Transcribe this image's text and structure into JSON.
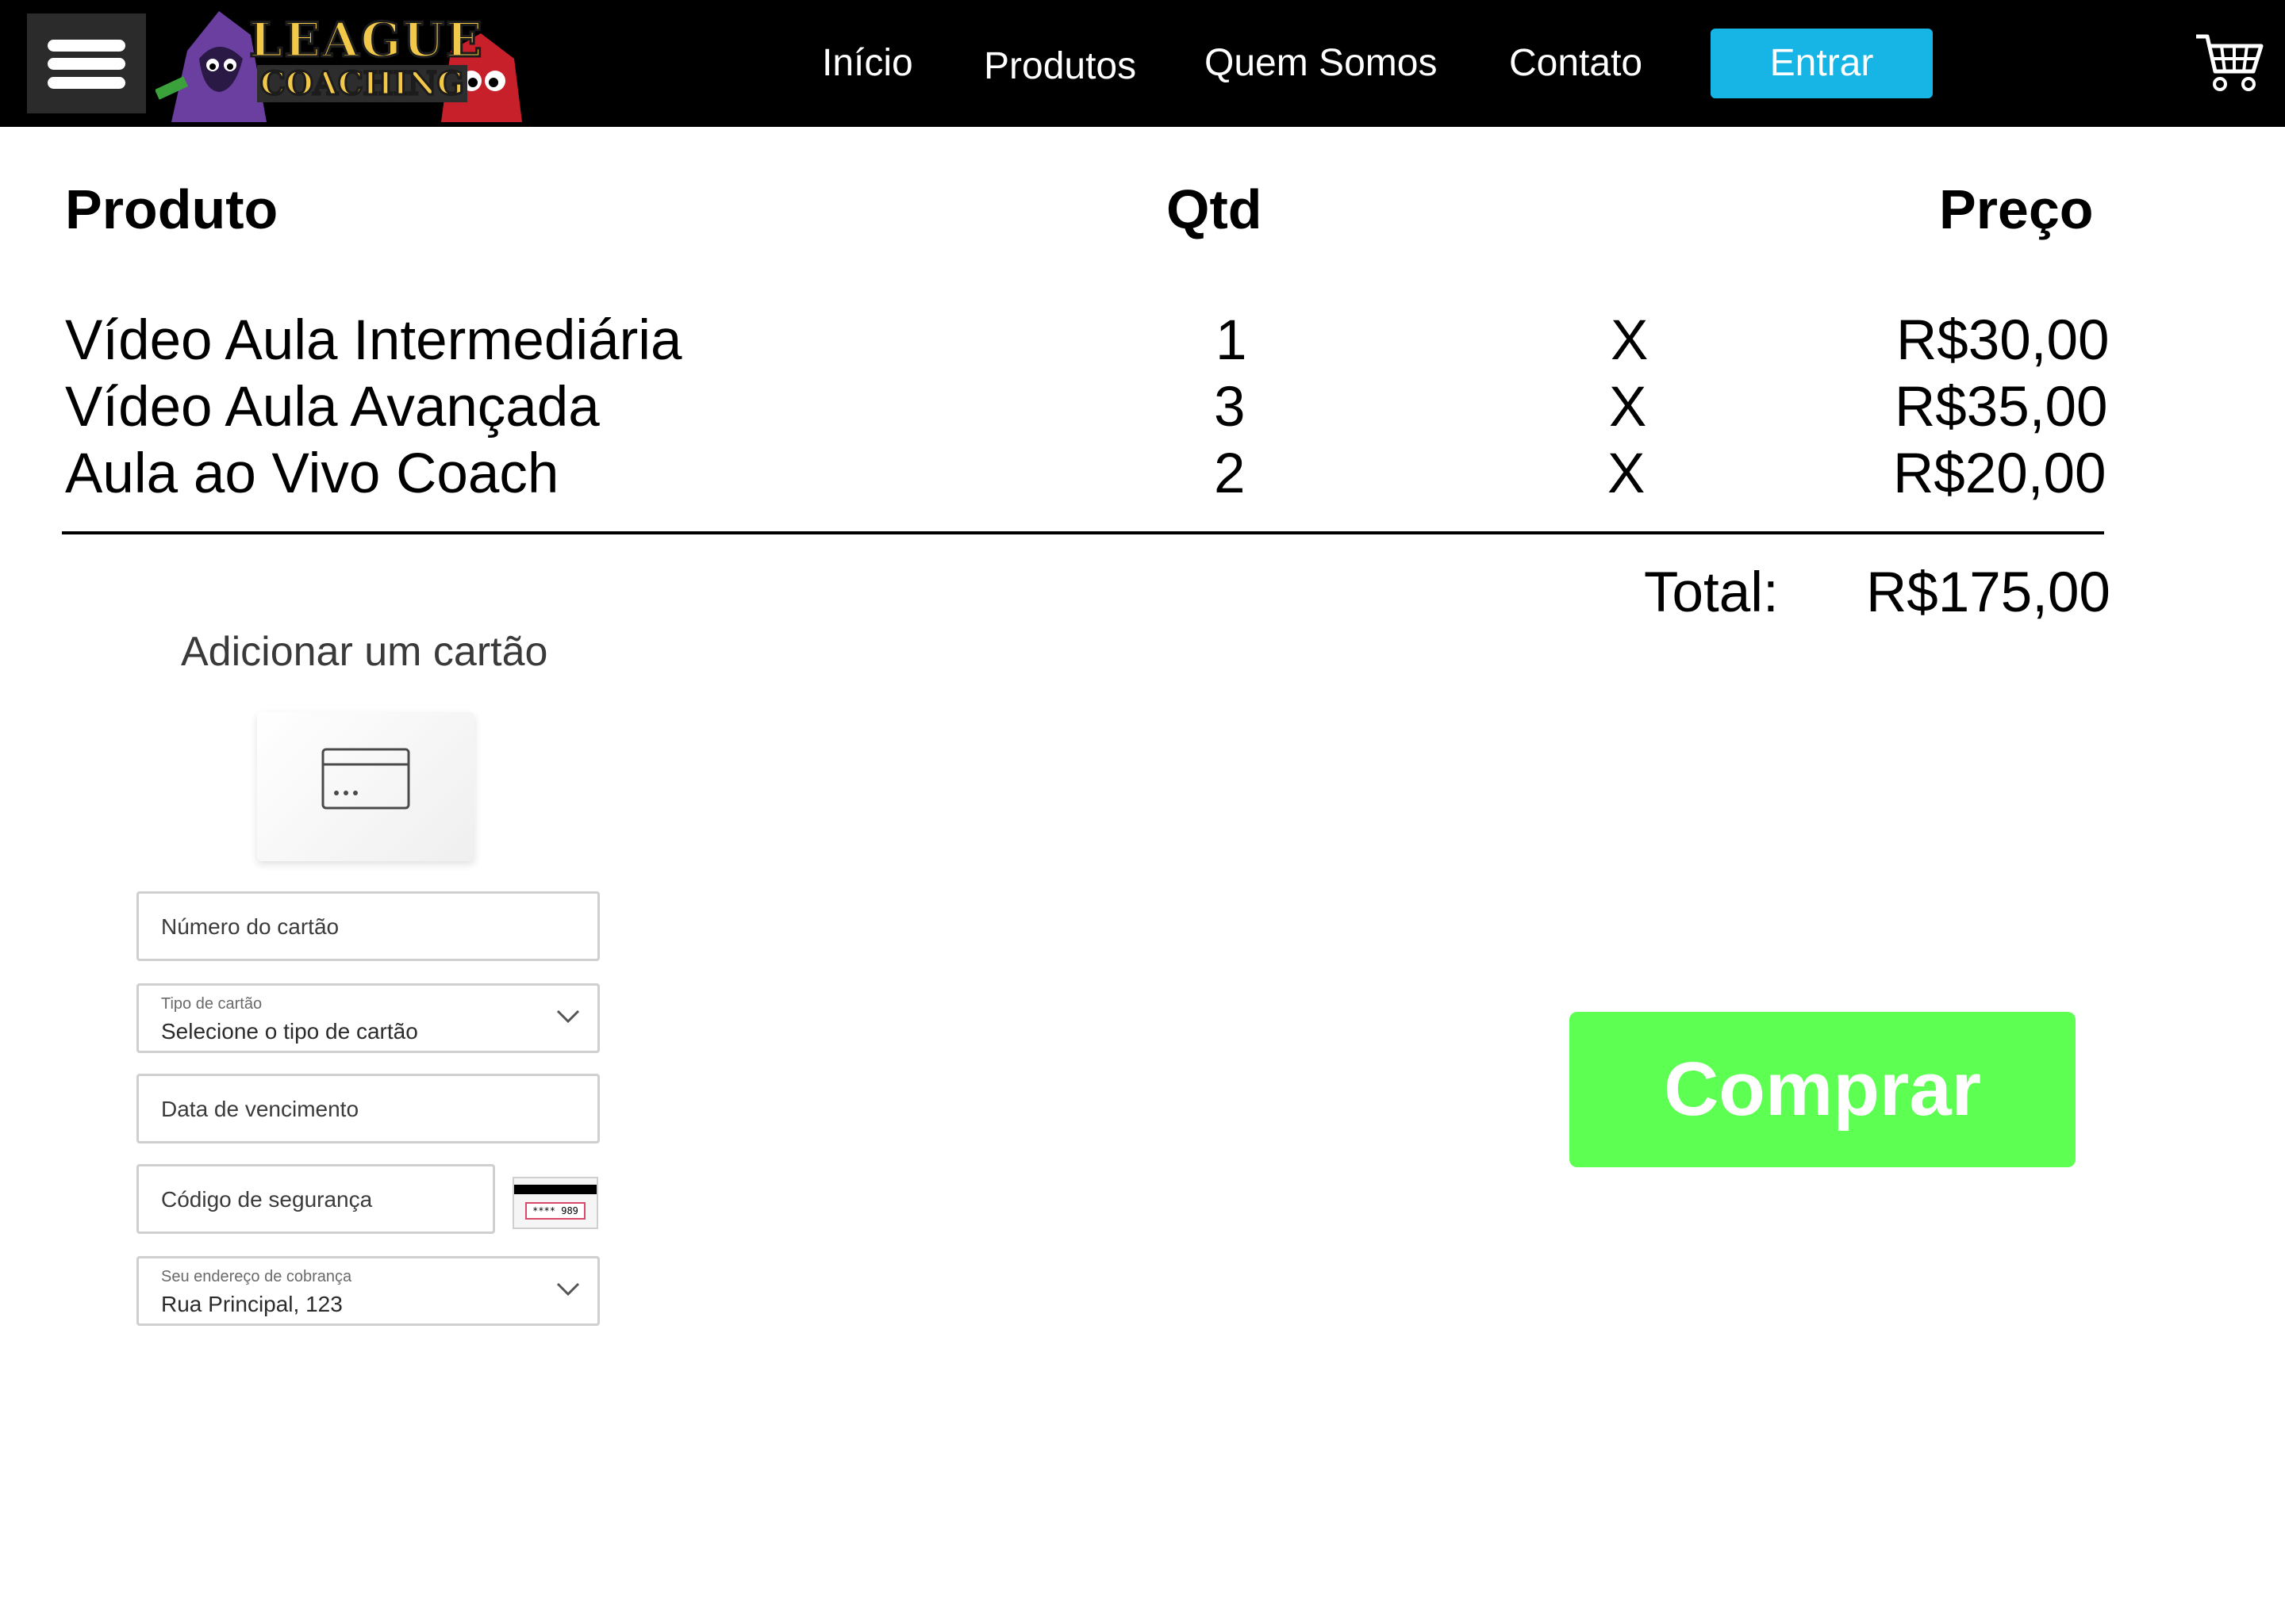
{
  "header": {
    "brand_line1": "LEAGUE",
    "brand_line2": "COACHING",
    "nav": [
      "Início",
      "Produtos",
      "Quem Somos",
      "Contato"
    ],
    "login_label": "Entrar",
    "icons": [
      "menu-icon",
      "cart-icon"
    ]
  },
  "cart": {
    "headers": {
      "product": "Produto",
      "qty": "Qtd",
      "price": "Preço"
    },
    "items": [
      {
        "name": "Vídeo Aula Intermediária",
        "qty": "1",
        "remove": "X",
        "price": "R$30,00"
      },
      {
        "name": "Vídeo Aula Avançada",
        "qty": "3",
        "remove": "X",
        "price": "R$35,00"
      },
      {
        "name": "Aula ao Vivo Coach",
        "qty": "2",
        "remove": "X",
        "price": "R$20,00"
      }
    ],
    "total_label": "Total:",
    "total_value": "R$175,00"
  },
  "payment": {
    "title": "Adicionar um cartão",
    "card_number_placeholder": "Número do cartão",
    "card_type_label": "Tipo de cartão",
    "card_type_value": "Selecione o tipo de cartão",
    "expiry_placeholder": "Data de vencimento",
    "cvv_placeholder": "Código de segurança",
    "cvv_hint": "**** 989",
    "billing_label": "Seu endereço de cobrança",
    "billing_value": "Rua Principal, 123"
  },
  "actions": {
    "buy_label": "Comprar"
  },
  "colors": {
    "header_bg": "#000000",
    "login_bg": "#17b5e6",
    "buy_bg": "#5cff52"
  }
}
